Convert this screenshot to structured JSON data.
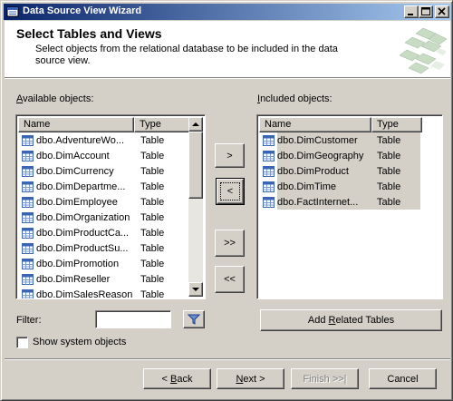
{
  "window": {
    "title": "Data Source View Wizard"
  },
  "header": {
    "title": "Select Tables and Views",
    "description": "Select objects from the relational database to be included in the data source view."
  },
  "available": {
    "label_prefix": "A",
    "label_rest": "vailable objects:",
    "columns": [
      "Name",
      "Type"
    ],
    "rows": [
      {
        "name": "dbo.AdventureWo...",
        "type": "Table"
      },
      {
        "name": "dbo.DimAccount",
        "type": "Table"
      },
      {
        "name": "dbo.DimCurrency",
        "type": "Table"
      },
      {
        "name": "dbo.DimDepartme...",
        "type": "Table"
      },
      {
        "name": "dbo.DimEmployee",
        "type": "Table"
      },
      {
        "name": "dbo.DimOrganization",
        "type": "Table"
      },
      {
        "name": "dbo.DimProductCa...",
        "type": "Table"
      },
      {
        "name": "dbo.DimProductSu...",
        "type": "Table"
      },
      {
        "name": "dbo.DimPromotion",
        "type": "Table"
      },
      {
        "name": "dbo.DimReseller",
        "type": "Table"
      },
      {
        "name": "dbo.DimSalesReason",
        "type": "Table"
      }
    ]
  },
  "included": {
    "label_prefix": "I",
    "label_rest": "ncluded objects:",
    "columns": [
      "Name",
      "Type"
    ],
    "rows": [
      {
        "name": "dbo.DimCustomer",
        "type": "Table"
      },
      {
        "name": "dbo.DimGeography",
        "type": "Table"
      },
      {
        "name": "dbo.DimProduct",
        "type": "Table"
      },
      {
        "name": "dbo.DimTime",
        "type": "Table"
      },
      {
        "name": "dbo.FactInternet...",
        "type": "Table"
      }
    ]
  },
  "transfer_buttons": {
    "add": ">",
    "remove": "<",
    "add_all": ">>",
    "remove_all": "<<"
  },
  "filter": {
    "label": "Filter:",
    "value": ""
  },
  "add_related_label": "Add Related Tables",
  "add_related_underline": "R",
  "show_system": {
    "label": "Show system objects",
    "checked": false
  },
  "footer": {
    "back": "< Back",
    "next": "Next >",
    "finish": "Finish >>|",
    "cancel": "Cancel"
  },
  "icons": {
    "table": "table-icon",
    "filter": "filter-icon"
  },
  "colors": {
    "title_gradient_start": "#0a246a",
    "title_gradient_end": "#a6caf0",
    "face": "#d4d0c8",
    "table_icon_blue": "#3a64b4"
  }
}
